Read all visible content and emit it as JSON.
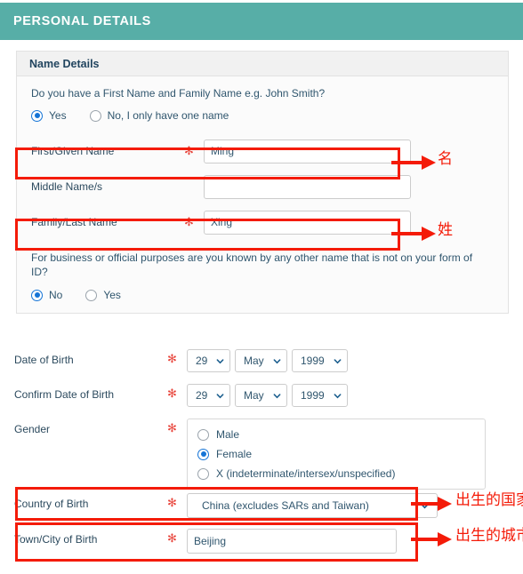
{
  "section": {
    "title": "PERSONAL DETAILS",
    "accent_color": "#57aea7"
  },
  "panel": {
    "title": "Name Details",
    "name_question": "Do you have a First Name and Family Name e.g. John Smith?",
    "name_question_options": [
      {
        "label": "Yes",
        "selected": true
      },
      {
        "label": "No, I only have one name",
        "selected": false
      }
    ],
    "fields": [
      {
        "label": "First/Given Name",
        "required": "✻",
        "value": "Ming",
        "placeholder": ""
      },
      {
        "label": "Middle Name/s",
        "required": "",
        "value": "",
        "placeholder": ""
      },
      {
        "label": "Family/Last Name",
        "required": "✻",
        "value": "Xing",
        "placeholder": ""
      }
    ],
    "other_name_question": "For business or official purposes are you known by any other name that is not on your form of ID?",
    "other_name_options": [
      {
        "label": "No",
        "selected": true
      },
      {
        "label": "Yes",
        "selected": false
      }
    ]
  },
  "dob": {
    "label": "Date of Birth",
    "required": "✻",
    "day": "29",
    "month": "May",
    "year": "1999"
  },
  "dob_confirm": {
    "label": "Confirm Date of Birth",
    "required": "✻",
    "day": "29",
    "month": "May",
    "year": "1999"
  },
  "gender": {
    "label": "Gender",
    "required": "✻",
    "options": [
      {
        "label": "Male",
        "selected": false
      },
      {
        "label": "Female",
        "selected": true
      },
      {
        "label": "X (indeterminate/intersex/unspecified)",
        "selected": false
      }
    ]
  },
  "country_of_birth": {
    "label": "Country of Birth",
    "required": "✻",
    "value": "China (excludes SARs and Taiwan)"
  },
  "town_of_birth": {
    "label": "Town/City of Birth",
    "required": "✻",
    "value": "Beijing",
    "placeholder": ""
  },
  "annotations": {
    "color": "#f41b08",
    "items": [
      {
        "name": "first-name",
        "text": "名"
      },
      {
        "name": "family-name",
        "text": "姓"
      },
      {
        "name": "country-of-birth",
        "text": "出生的国家"
      },
      {
        "name": "town-of-birth",
        "text": "出生的城市"
      }
    ]
  },
  "icons": {
    "caret_down": "chevron-down-icon",
    "arrow_right": "arrow-right-icon"
  }
}
